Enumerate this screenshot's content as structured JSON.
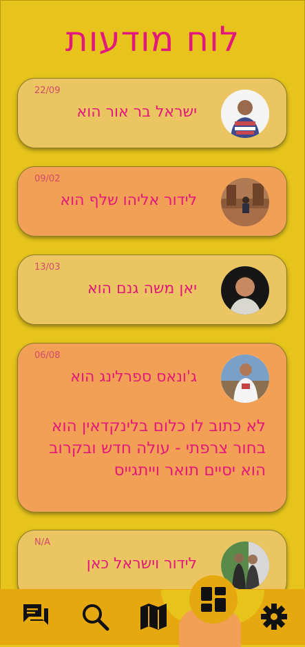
{
  "title": "לוח מודעות",
  "cards": [
    {
      "date": "22/09",
      "name": "ישראל בר אור הוא",
      "style": "light"
    },
    {
      "date": "09/02",
      "name": "לידור אליהו שלף הוא",
      "style": "orange"
    },
    {
      "date": "13/03",
      "name": "יאן משה גנם הוא",
      "style": "light"
    },
    {
      "date": "06/08",
      "name": "ג'ונאס ספרלינג הוא",
      "style": "orange",
      "body": "לא כתוב לו כלום בלינקדאין הוא בחור צרפתי - עולה חדש ובקרוב הוא יסיים תואר וייתגייס"
    },
    {
      "date": "N/A",
      "name": "לידור וישראל כאן",
      "style": "light"
    }
  ],
  "nav": {
    "items": [
      "chat-icon",
      "search-icon",
      "map-icon",
      "dashboard-icon",
      "settings-icon"
    ],
    "active": "dashboard-icon"
  },
  "colors": {
    "background": "#e6c41c",
    "card_light": "#eac562",
    "card_orange": "#f2a055",
    "accent_text": "#e2197a",
    "navbar": "#e5a80e"
  }
}
